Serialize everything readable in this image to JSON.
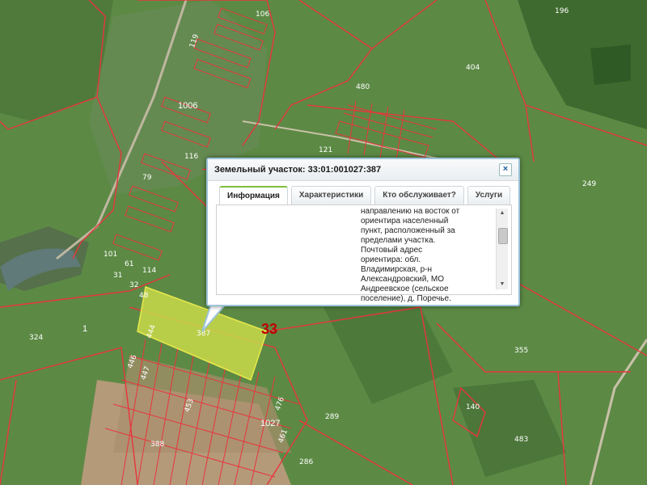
{
  "popup": {
    "title": "Земельный участок: 33:01:001027:387",
    "close_symbol": "×",
    "tabs": [
      "Информация",
      "Характеристики",
      "Кто обслуживает?",
      "Услуги"
    ],
    "text": [
      "направлению на восток от",
      "ориентира населенный",
      "пункт, расположенный за",
      "пределами участка.",
      "Почтовый адрес",
      "ориентира: обл.",
      "Владимирская, р-н",
      "Александровский, МО",
      "Андреевское (сельское",
      "поселение), д. Поречье."
    ]
  },
  "map": {
    "highlight_color": "#c8d94a",
    "boundary_color": "#e8353d",
    "labels": {
      "l196": "196",
      "l106": "106",
      "l119": "119",
      "l1006": "1006",
      "l404": "404",
      "l480": "480",
      "l249": "249",
      "l121": "121",
      "l116": "116",
      "l79": "79",
      "l101": "101",
      "l61": "61",
      "l114": "114",
      "l31": "31",
      "l32": "32",
      "l48": "48",
      "l387": "387",
      "l33": "33",
      "l1": "1",
      "l324": "324",
      "l355": "355",
      "l444": "444",
      "l446": "446",
      "l447": "447",
      "l388": "388",
      "l1027": "1027",
      "l289": "289",
      "l140": "140",
      "l483": "483",
      "l286": "286",
      "l461": "461",
      "l476": "476",
      "l453": "453"
    }
  }
}
